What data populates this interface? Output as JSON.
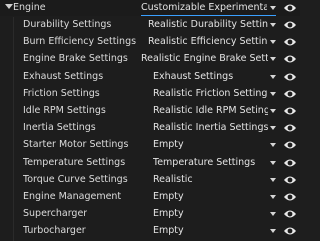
{
  "header": {
    "label": "Engine",
    "value": "Customizable Experimental..."
  },
  "rows": [
    {
      "label": "Durability Settings",
      "value": "Realistic Durability Settings"
    },
    {
      "label": "Burn Efficiency Settings",
      "value": "Realistic Efficiency Settings"
    },
    {
      "label": "Engine Brake Settings",
      "value": "Realistic Engine Brake Settings"
    },
    {
      "label": "Exhaust Settings",
      "value": "Exhaust Settings"
    },
    {
      "label": "Friction Settings",
      "value": "Realistic Friction Settings"
    },
    {
      "label": "Idle RPM Settings",
      "value": "Realistic Idle RPM Seting"
    },
    {
      "label": "Inertia Settings",
      "value": "Realistic Inertia Settings"
    },
    {
      "label": "Starter Motor Settings",
      "value": "Empty"
    },
    {
      "label": "Temperature Settings",
      "value": "Temperature Settings"
    },
    {
      "label": "Torque Curve Settings",
      "value": "Realistic"
    },
    {
      "label": "Engine Management",
      "value": "Empty"
    },
    {
      "label": "Supercharger",
      "value": "Empty"
    },
    {
      "label": "Turbocharger",
      "value": "Empty"
    }
  ],
  "icons": {
    "dropdown": "chevron-down-icon",
    "visibility": "eye-icon"
  },
  "colors": {
    "accent": "#3aa0ff",
    "background": "#1d1d1d",
    "text": "#e4e4e4"
  }
}
